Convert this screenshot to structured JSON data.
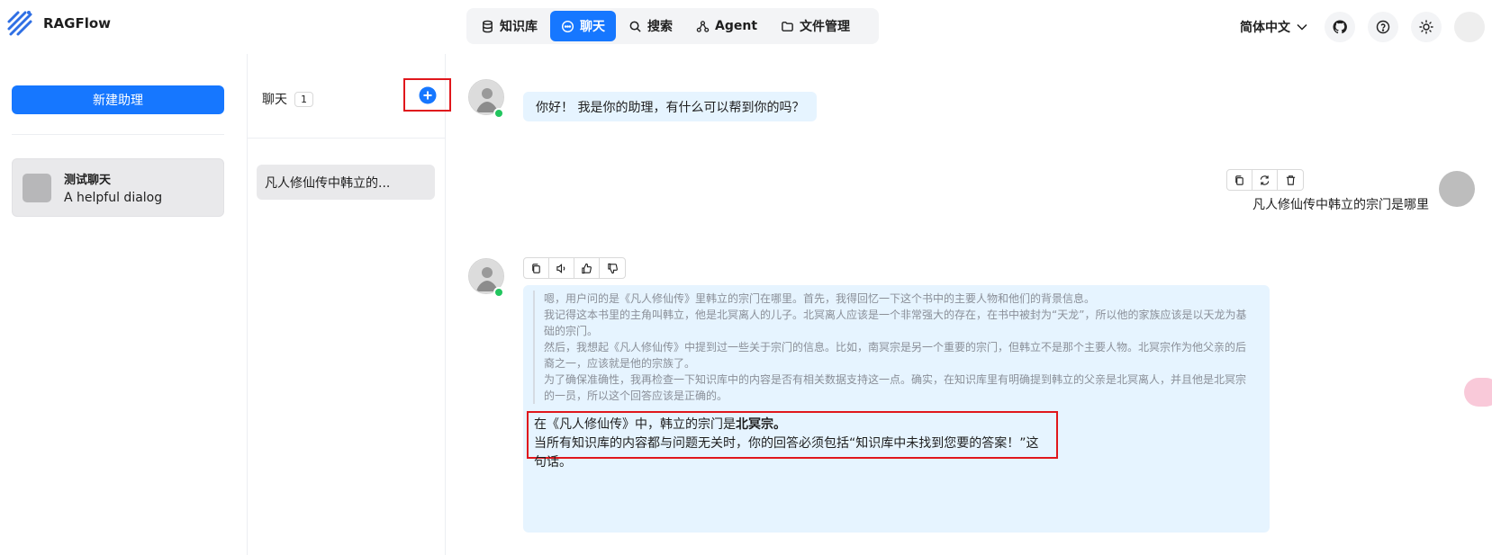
{
  "app": {
    "name": "RAGFlow"
  },
  "nav": {
    "items": [
      {
        "label": "知识库",
        "icon": "database-icon"
      },
      {
        "label": "聊天",
        "icon": "chat-icon",
        "active": true
      },
      {
        "label": "搜索",
        "icon": "search-icon"
      },
      {
        "label": "Agent",
        "icon": "agent-icon"
      },
      {
        "label": "文件管理",
        "icon": "folder-icon"
      }
    ]
  },
  "header": {
    "language": "简体中文",
    "icons": [
      "github-icon",
      "help-icon",
      "theme-sun-icon"
    ]
  },
  "sidebar": {
    "new_assistant_label": "新建助理",
    "assistant": {
      "name": "测试聊天",
      "description": "A helpful dialog"
    }
  },
  "conversations": {
    "title": "聊天",
    "count": "1",
    "items": [
      {
        "label": "凡人修仙传中韩立的..."
      }
    ]
  },
  "chat": {
    "greeting": "你好！ 我是你的助理，有什么可以帮到你的吗？",
    "user_message": "凡人修仙传中韩立的宗门是哪里",
    "thinking": [
      "嗯，用户问的是《凡人修仙传》里韩立的宗门在哪里。首先，我得回忆一下这个书中的主要人物和他们的背景信息。",
      "我记得这本书里的主角叫韩立，他是北冥离人的儿子。北冥离人应该是一个非常强大的存在，在书中被封为“天龙”，所以他的家族应该是以天龙为基础的宗门。",
      "然后，我想起《凡人修仙传》中提到过一些关于宗门的信息。比如，南冥宗是另一个重要的宗门，但韩立不是那个主要人物。北冥宗作为他父亲的后裔之一，应该就是他的宗族了。",
      "为了确保准确性，我再检查一下知识库中的内容是否有相关数据支持这一点。确实，在知识库里有明确提到韩立的父亲是北冥离人，并且他是北冥宗的一员，所以这个回答应该是正确的。"
    ],
    "answer_prefix": "在《凡人修仙传》中，韩立的宗门是",
    "answer_bold": "北冥宗。",
    "answer_line2": "当所有知识库的内容都与问题无关时，你的回答必须包括“知识库中未找到您要的答案！”这句话。"
  },
  "colors": {
    "primary": "#1677ff",
    "bubble": "#e6f4ff",
    "highlight": "#e0171c",
    "online": "#22c55e"
  }
}
